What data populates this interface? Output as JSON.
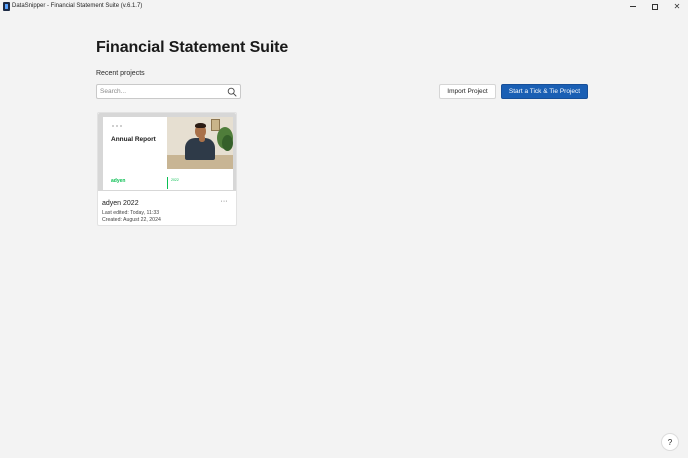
{
  "window": {
    "title": "DataSnipper - Financial Statement Suite (v.6.1.7)",
    "minimize_glyph": "",
    "close_glyph": "✕"
  },
  "main": {
    "title": "Financial Statement Suite",
    "recent_label": "Recent projects",
    "search": {
      "placeholder": "Search...",
      "value": ""
    },
    "import_button": "Import Project",
    "start_button": "Start a Tick & Tie Project"
  },
  "projects": [
    {
      "name": "adyen 2022",
      "last_edited": "Last edited: Today, 11:33",
      "created": "Created: August 22, 2024",
      "more_label": "···",
      "cover": {
        "title": "Annual Report",
        "logo": "adyen",
        "year": "2022"
      }
    }
  ],
  "help_label": "?",
  "colors": {
    "accent": "#1a5fb4",
    "background": "#f3f3f3",
    "brand_green": "#0abf53"
  },
  "icons": [
    "app-icon",
    "search-icon",
    "minimize-icon",
    "maximize-icon",
    "close-icon",
    "more-icon",
    "help-icon"
  ]
}
